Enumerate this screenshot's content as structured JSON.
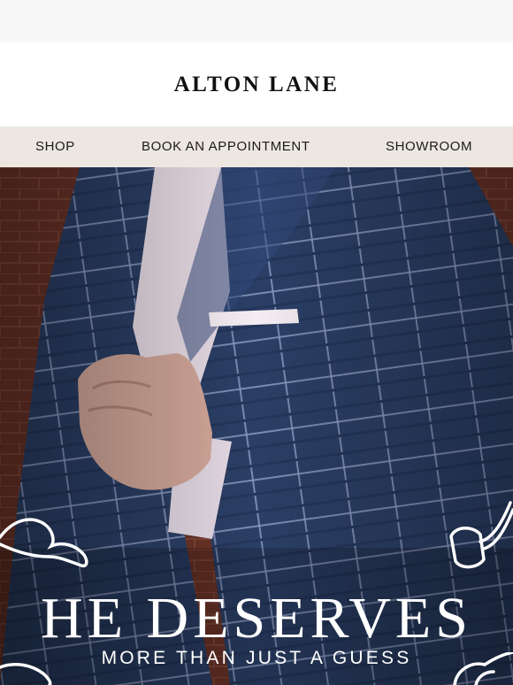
{
  "brand": {
    "logo_text": "ALTON LANE"
  },
  "nav": {
    "items": [
      {
        "label": "SHOP"
      },
      {
        "label": "BOOK AN APPOINTMENT"
      },
      {
        "label": "SHOWROOM"
      }
    ]
  },
  "hero": {
    "headline": "HE DESERVES",
    "subheadline": "MORE THAN JUST A GUESS"
  },
  "colors": {
    "nav_background": "#ede7e1",
    "jacket_navy": "#2b3f66",
    "brick": "#6a3327",
    "text_dark": "#111111"
  },
  "icons": [
    "mustache-icon",
    "pipe-icon"
  ]
}
